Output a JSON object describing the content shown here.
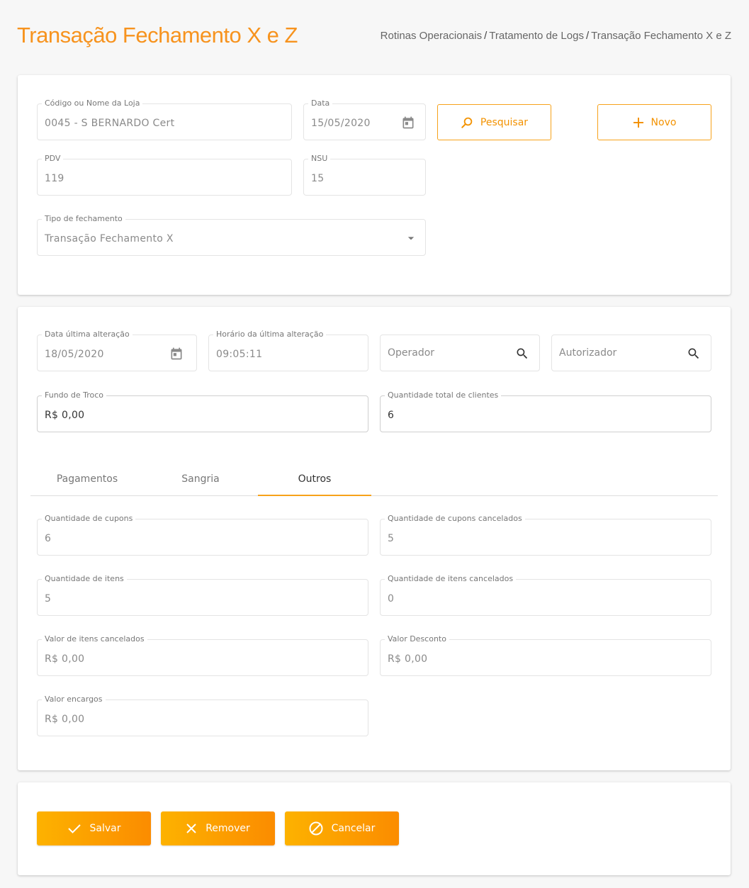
{
  "page": {
    "title": "Transação Fechamento X e Z",
    "breadcrumb": [
      "Rotinas Operacionais",
      "Tratamento de Logs",
      "Transação Fechamento X e Z"
    ]
  },
  "filters": {
    "loja": {
      "label": "Código ou Nome da Loja",
      "value": "0045 - S BERNARDO Cert"
    },
    "data": {
      "label": "Data",
      "value": "15/05/2020"
    },
    "pdv": {
      "label": "PDV",
      "value": "119"
    },
    "nsu": {
      "label": "NSU",
      "value": "15"
    },
    "tipo": {
      "label": "Tipo de fechamento",
      "value": "Transação Fechamento X"
    },
    "search_label": "Pesquisar",
    "new_label": "Novo"
  },
  "details": {
    "data_alteracao": {
      "label": "Data última alteração",
      "value": "18/05/2020"
    },
    "horario_alteracao": {
      "label": "Horário da última alteração",
      "value": "09:05:11"
    },
    "operador": {
      "placeholder": "Operador"
    },
    "autorizador": {
      "placeholder": "Autorizador"
    },
    "fundo_troco": {
      "label": "Fundo de Troco",
      "value": "R$ 0,00"
    },
    "qtd_clientes": {
      "label": "Quantidade total de clientes",
      "value": "6"
    }
  },
  "tabs": [
    {
      "label": "Pagamentos",
      "active": false
    },
    {
      "label": "Sangria",
      "active": false
    },
    {
      "label": "Outros",
      "active": true
    }
  ],
  "outros": {
    "qtd_cupons": {
      "label": "Quantidade de cupons",
      "value": "6"
    },
    "qtd_cupons_cancelados": {
      "label": "Quantidade de cupons cancelados",
      "value": "5"
    },
    "qtd_itens": {
      "label": "Quantidade de itens",
      "value": "5"
    },
    "qtd_itens_cancelados": {
      "label": "Quantidade de itens cancelados",
      "value": "0"
    },
    "valor_itens_cancelados": {
      "label": "Valor de itens cancelados",
      "value": "R$ 0,00"
    },
    "valor_desconto": {
      "label": "Valor Desconto",
      "value": "R$ 0,00"
    },
    "valor_encargos": {
      "label": "Valor encargos",
      "value": "R$ 0,00"
    }
  },
  "actions": {
    "save": "Salvar",
    "remove": "Remover",
    "cancel": "Cancelar"
  },
  "colors": {
    "accent": "#f7931e",
    "button_gradient_start": "#fdb200",
    "button_gradient_end": "#fb8c00"
  }
}
